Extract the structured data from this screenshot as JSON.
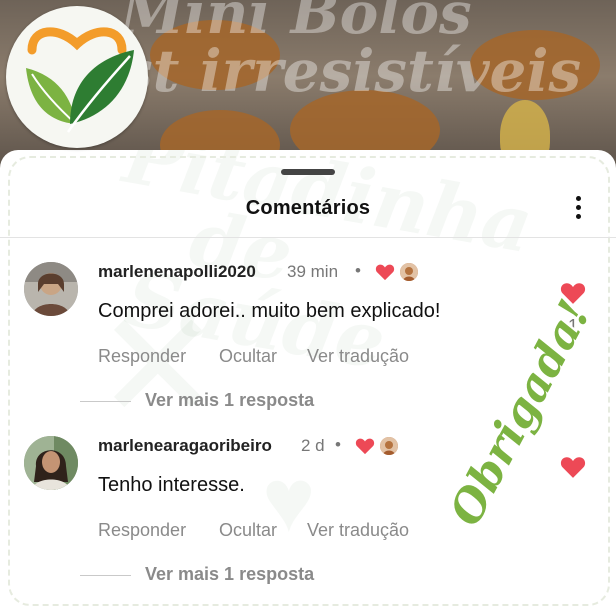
{
  "background": {
    "title_line1": "Mini Bolos",
    "title_line2": "st irresistíveis"
  },
  "watermark": {
    "text": "Pitadinha\n   de\n Saúde"
  },
  "header": {
    "title": "Comentários",
    "menu_icon": "more-vertical-icon"
  },
  "comments": [
    {
      "username": "marlenenapolli2020",
      "time": "39 min",
      "text": "Comprei adorei.. muito bem explicado!",
      "reply_label": "Responder",
      "hide_label": "Ocultar",
      "translate_label": "Ver tradução",
      "more_replies": "Ver mais 1 resposta",
      "like_count": "1",
      "creator_liked": true
    },
    {
      "username": "marlenearagaoribeiro",
      "time": "2 d",
      "text": "Tenho interesse.",
      "reply_label": "Responder",
      "hide_label": "Ocultar",
      "translate_label": "Ver tradução",
      "more_replies": "Ver mais 1 resposta",
      "like_count": "",
      "creator_liked": true
    }
  ],
  "overlay_text": "Obrigada!",
  "colors": {
    "like_red": "#ed4956",
    "brand_green": "#7cb342",
    "brand_orange": "#f39c2a"
  }
}
